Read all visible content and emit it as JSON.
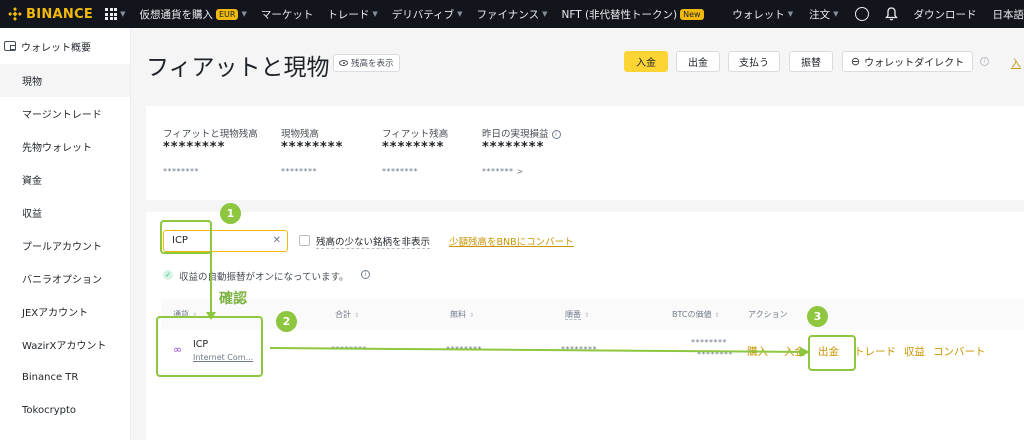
{
  "topbar": {
    "logo": "BINANCE",
    "nav": [
      {
        "label": "仮想通貨を購入",
        "badge": "EUR"
      },
      {
        "label": "マーケット"
      },
      {
        "label": "トレード"
      },
      {
        "label": "デリバティブ"
      },
      {
        "label": "ファイナンス"
      },
      {
        "label": "NFT (非代替性トークン)",
        "badge": "New"
      }
    ],
    "right": {
      "wallet": "ウォレット",
      "orders": "注文",
      "download": "ダウンロード",
      "lang": "日本語"
    }
  },
  "sidebar": {
    "items": [
      {
        "label": "ウォレット概要"
      },
      {
        "label": "現物"
      },
      {
        "label": "マージントレード"
      },
      {
        "label": "先物ウォレット"
      },
      {
        "label": "資金"
      },
      {
        "label": "収益"
      },
      {
        "label": "プールアカウント"
      },
      {
        "label": "バニラオプション"
      },
      {
        "label": "JEXアカウント"
      },
      {
        "label": "WazirXアカウント"
      },
      {
        "label": "Binance TR"
      },
      {
        "label": "Tokocrypto"
      }
    ]
  },
  "header": {
    "title": "フィアットと現物",
    "show_balance": "残高を表示",
    "deposit": "入金",
    "withdraw": "出金",
    "pay": "支払う",
    "transfer": "振替",
    "wallet_direct": "ウォレットダイレクト",
    "cut_link": "入"
  },
  "balances": [
    {
      "label": "フィアットと現物残高",
      "value": "********",
      "sub": "********"
    },
    {
      "label": "現物残高",
      "value": "********",
      "sub": "********"
    },
    {
      "label": "フィアット残高",
      "value": "********",
      "sub": "********"
    },
    {
      "label": "昨日の実現損益",
      "value": "********",
      "sub": "******* >"
    }
  ],
  "filters": {
    "search_value": "ICP",
    "hide_small": "残高の少ない銘柄を非表示",
    "convert_link": "少額残高をBNBにコンバート",
    "auto_transfer": "収益の自動振替がオンになっています。"
  },
  "table": {
    "headers": [
      "通貨",
      "合計",
      "無料",
      "順番",
      "BTCの価値",
      "アクション"
    ],
    "row": {
      "symbol": "ICP",
      "name": "Internet Com...",
      "total": "********",
      "free": "********",
      "order": "********",
      "btc_top": "********",
      "btc_bottom": "********",
      "actions": [
        "購入",
        "入金",
        "出金",
        "トレード",
        "収益",
        "コンバート"
      ]
    }
  },
  "annotations": {
    "step1": "1",
    "step2": "2",
    "step3": "3",
    "confirm": "確認",
    "color": "#8dc63f"
  },
  "colors": {
    "accent": "#f0b90b",
    "brand_yellow": "#fcd535",
    "link": "#c99400",
    "topbar_bg": "#12161c"
  }
}
